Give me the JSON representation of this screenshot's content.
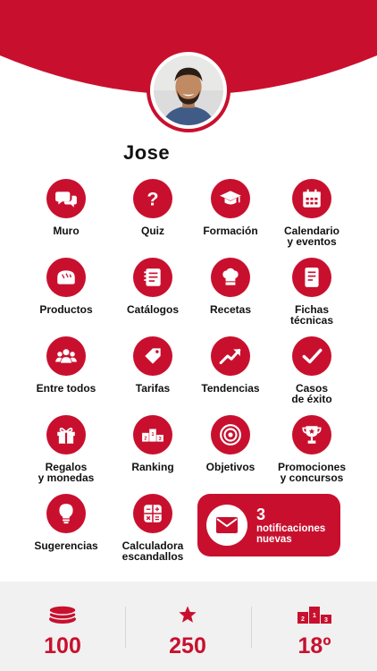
{
  "theme": {
    "accent": "#c8102e",
    "footer_bg": "#f1f1f1"
  },
  "profile": {
    "name": "Jose",
    "avatar_icon": "user-photo"
  },
  "menu": [
    {
      "id": "muro",
      "label": "Muro",
      "icon": "chat-bubbles-icon"
    },
    {
      "id": "quiz",
      "label": "Quiz",
      "icon": "question-mark-icon"
    },
    {
      "id": "formacion",
      "label": "Formación",
      "icon": "graduation-cap-icon"
    },
    {
      "id": "calendario",
      "label": "Calendario\ny eventos",
      "icon": "calendar-icon"
    },
    {
      "id": "productos",
      "label": "Productos",
      "icon": "bread-icon"
    },
    {
      "id": "catalogos",
      "label": "Catálogos",
      "icon": "notebook-icon"
    },
    {
      "id": "recetas",
      "label": "Recetas",
      "icon": "chef-hat-icon"
    },
    {
      "id": "fichas",
      "label": "Fichas\ntécnicas",
      "icon": "document-icon"
    },
    {
      "id": "entre-todos",
      "label": "Entre todos",
      "icon": "group-icon"
    },
    {
      "id": "tarifas",
      "label": "Tarifas",
      "icon": "price-tag-icon"
    },
    {
      "id": "tendencias",
      "label": "Tendencias",
      "icon": "trend-up-icon"
    },
    {
      "id": "casos",
      "label": "Casos\nde éxito",
      "icon": "checkmark-icon"
    },
    {
      "id": "regalos",
      "label": "Regalos\ny monedas",
      "icon": "gift-icon"
    },
    {
      "id": "ranking",
      "label": "Ranking",
      "icon": "podium-icon"
    },
    {
      "id": "objetivos",
      "label": "Objetivos",
      "icon": "target-icon"
    },
    {
      "id": "promociones",
      "label": "Promociones\ny concursos",
      "icon": "trophy-icon"
    },
    {
      "id": "sugerencias",
      "label": "Sugerencias",
      "icon": "lightbulb-icon"
    },
    {
      "id": "calculadora",
      "label": "Calculadora\nescandallos",
      "icon": "calculator-icon"
    }
  ],
  "notifications": {
    "count": "3",
    "text": "notificaciones\nnuevas",
    "icon": "envelope-icon"
  },
  "stats": [
    {
      "id": "coins",
      "value": "100",
      "icon": "coins-icon"
    },
    {
      "id": "points",
      "value": "250",
      "icon": "star-icon"
    },
    {
      "id": "rank",
      "value": "18º",
      "icon": "podium-icon"
    }
  ]
}
